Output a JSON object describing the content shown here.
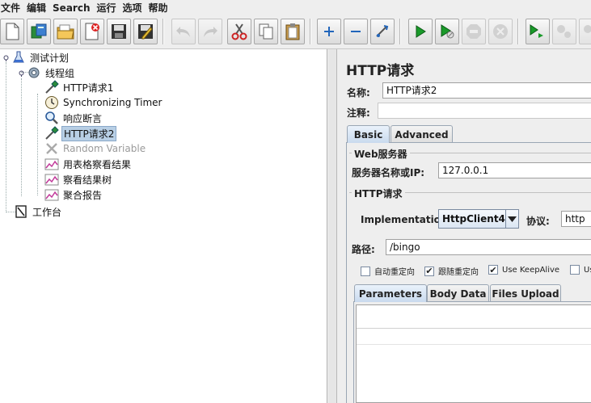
{
  "menu": [
    "文件",
    "编辑",
    "Search",
    "运行",
    "选项",
    "帮助"
  ],
  "toolbar": {
    "buttons": [
      {
        "name": "new",
        "icon": "new-file-icon"
      },
      {
        "name": "templates",
        "icon": "templates-icon"
      },
      {
        "name": "open",
        "icon": "open-folder-icon"
      },
      {
        "name": "close",
        "icon": "close-file-icon"
      },
      {
        "name": "save",
        "icon": "save-icon"
      },
      {
        "name": "save-as",
        "icon": "edit-save-icon"
      },
      {
        "name": "undo",
        "icon": "undo-icon"
      },
      {
        "name": "redo",
        "icon": "redo-icon"
      },
      {
        "name": "cut",
        "icon": "scissors-icon"
      },
      {
        "name": "copy",
        "icon": "copy-icon"
      },
      {
        "name": "paste",
        "icon": "paste-icon"
      },
      {
        "name": "expand",
        "icon": "plus-icon"
      },
      {
        "name": "collapse",
        "icon": "minus-icon"
      },
      {
        "name": "toggle",
        "icon": "toggle-icon"
      },
      {
        "name": "start",
        "icon": "play-icon"
      },
      {
        "name": "start-no-pause",
        "icon": "play-no-timer-icon"
      },
      {
        "name": "stop",
        "icon": "stop-icon"
      },
      {
        "name": "shutdown",
        "icon": "shutdown-icon"
      },
      {
        "name": "remote-start",
        "icon": "remote-play-icon"
      },
      {
        "name": "remote-stop",
        "icon": "remote-stop-icon"
      },
      {
        "name": "remote-exit",
        "icon": "remote-exit-icon"
      }
    ]
  },
  "tree": {
    "test_plan": "测试计划",
    "thread_group": "线程组",
    "items": [
      {
        "label": "HTTP请求1",
        "icon": "pipette-icon",
        "selected": false,
        "disabled": false
      },
      {
        "label": "Synchronizing Timer",
        "icon": "timer-icon",
        "selected": false,
        "disabled": false
      },
      {
        "label": "响应断言",
        "icon": "magnifier-icon",
        "selected": false,
        "disabled": false
      },
      {
        "label": "HTTP请求2",
        "icon": "pipette-icon",
        "selected": true,
        "disabled": false
      },
      {
        "label": "Random Variable",
        "icon": "cross-tools-icon",
        "selected": false,
        "disabled": true
      },
      {
        "label": "用表格察看结果",
        "icon": "graph-icon",
        "selected": false,
        "disabled": false
      },
      {
        "label": "察看结果树",
        "icon": "graph-icon",
        "selected": false,
        "disabled": false
      },
      {
        "label": "聚合报告",
        "icon": "graph-icon",
        "selected": false,
        "disabled": false
      }
    ],
    "workbench": "工作台"
  },
  "sampler": {
    "title": "HTTP请求",
    "name_label": "名称:",
    "name_value": "HTTP请求2",
    "comment_label": "注释:",
    "comment_value": "",
    "tabs": [
      "Basic",
      "Advanced"
    ],
    "web_server_group": "Web服务器",
    "server_label": "服务器名称或IP:",
    "server_value": "127.0.0.1",
    "http_request_group": "HTTP请求",
    "implementation_label": "Implementation:",
    "implementation_value": "HttpClient4",
    "protocol_label": "协议:",
    "protocol_value": "http",
    "path_label": "路径:",
    "path_value": "/bingo",
    "checkboxes": [
      {
        "label": "自动重定向",
        "checked": false
      },
      {
        "label": "跟随重定向",
        "checked": true
      },
      {
        "label": "Use KeepAlive",
        "checked": true
      },
      {
        "label": "Us",
        "checked": false
      }
    ],
    "param_tabs": [
      "Parameters",
      "Body Data",
      "Files Upload"
    ]
  }
}
